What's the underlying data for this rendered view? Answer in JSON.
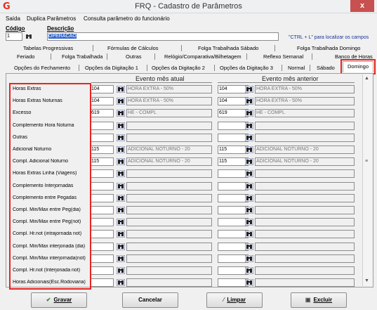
{
  "window": {
    "title": "FRQ - Cadastro de Parâmetros",
    "logo": "G",
    "close": "x"
  },
  "menu": [
    "Saída",
    "Duplica Parâmetros",
    "Consulta parâmetro do funcionário"
  ],
  "form": {
    "codigo_label": "Código",
    "codigo_value": "1",
    "descricao_label": "Descrição",
    "descricao_value": "OPERACAO",
    "hint": "\"CTRL + L\" para localizar os campos"
  },
  "tabs_row1": [
    "Tabelas Progressivas",
    "Fórmulas de Cálculos",
    "Folga Trabalhada Sábado",
    "Folga Trabalhada Domingo"
  ],
  "tabs_row2": [
    "Feriado",
    "Folga Trabalhada",
    "Outras",
    "Relógio/Comparativa/Bilhetagem",
    "Reflexo Semanal",
    "Banco de Horas"
  ],
  "tabs_row3": [
    "Opções do Fechamento",
    "Opções da Digitação 1",
    "Opções da Digitação 2",
    "Opções da Digitação 3",
    "Normal",
    "Sábado",
    "Domingo"
  ],
  "columns": {
    "current": "Evento mês atual",
    "previous": "Evento mês anterior"
  },
  "rows": [
    {
      "label": "Horas Extras",
      "cur_code": "104",
      "cur_desc": "HORA EXTRA - 50%",
      "prev_code": "104",
      "prev_desc": "HORA EXTRA - 50%"
    },
    {
      "label": "Horas Extras Noturnas",
      "cur_code": "104",
      "cur_desc": "HORA EXTRA - 50%",
      "prev_code": "104",
      "prev_desc": "HORA EXTRA - 50%"
    },
    {
      "label": "Excesso",
      "cur_code": "619",
      "cur_desc": "HE - COMPL",
      "prev_code": "619",
      "prev_desc": "HE - COMPL"
    },
    {
      "label": "Complemento Hora Noturna",
      "cur_code": "",
      "cur_desc": "",
      "prev_code": "",
      "prev_desc": ""
    },
    {
      "label": "Outras",
      "cur_code": "",
      "cur_desc": "",
      "prev_code": "",
      "prev_desc": ""
    },
    {
      "label": "Adicional Noturno",
      "cur_code": "115",
      "cur_desc": "ADICIONAL NOTURNO - 20",
      "prev_code": "115",
      "prev_desc": "ADICIONAL NOTURNO - 20"
    },
    {
      "label": "Compl. Adicional Noturno",
      "cur_code": "115",
      "cur_desc": "ADICIONAL NOTURNO - 20",
      "prev_code": "115",
      "prev_desc": "ADICIONAL NOTURNO - 20"
    },
    {
      "label": "Horas Extras Linha (Viagens)",
      "cur_code": "",
      "cur_desc": "",
      "prev_code": "",
      "prev_desc": ""
    },
    {
      "label": "Complemento Interjornadas",
      "cur_code": "",
      "cur_desc": "",
      "prev_code": "",
      "prev_desc": ""
    },
    {
      "label": "Complemento entre Pegadas",
      "cur_code": "",
      "cur_desc": "",
      "prev_code": "",
      "prev_desc": ""
    },
    {
      "label": "Compl. Min/Max entre Peg(dia)",
      "cur_code": "",
      "cur_desc": "",
      "prev_code": "",
      "prev_desc": ""
    },
    {
      "label": "Compl. Min/Max entre Peg(not)",
      "cur_code": "",
      "cur_desc": "",
      "prev_code": "",
      "prev_desc": ""
    },
    {
      "label": "Compl. Hr.not (intrajornada not)",
      "cur_code": "",
      "cur_desc": "",
      "prev_code": "",
      "prev_desc": ""
    },
    {
      "label": "Compl. Min/Max interjonada (dia)",
      "cur_code": "",
      "cur_desc": "",
      "prev_code": "",
      "prev_desc": ""
    },
    {
      "label": "Compl. Min/Max interjornada(not)",
      "cur_code": "",
      "cur_desc": "",
      "prev_code": "",
      "prev_desc": ""
    },
    {
      "label": "Compl. Hr.not (Interjonada not)",
      "cur_code": "",
      "cur_desc": "",
      "prev_code": "",
      "prev_desc": ""
    },
    {
      "label": "Horas Adicionais(Esc.Rodoviaria)",
      "cur_code": "",
      "cur_desc": "",
      "prev_code": "",
      "prev_desc": ""
    }
  ],
  "buttons": {
    "gravar": "Gravar",
    "cancelar": "Cancelar",
    "limpar": "Limpar",
    "excluir": "Excluir"
  },
  "icons": {
    "lookup": "binoculars-icon",
    "gravar": "checkmark-icon",
    "limpar": "broom-icon",
    "excluir": "printer-icon"
  },
  "colors": {
    "highlight": "#e8231f",
    "selection": "#3366cc",
    "close": "#c75050"
  }
}
